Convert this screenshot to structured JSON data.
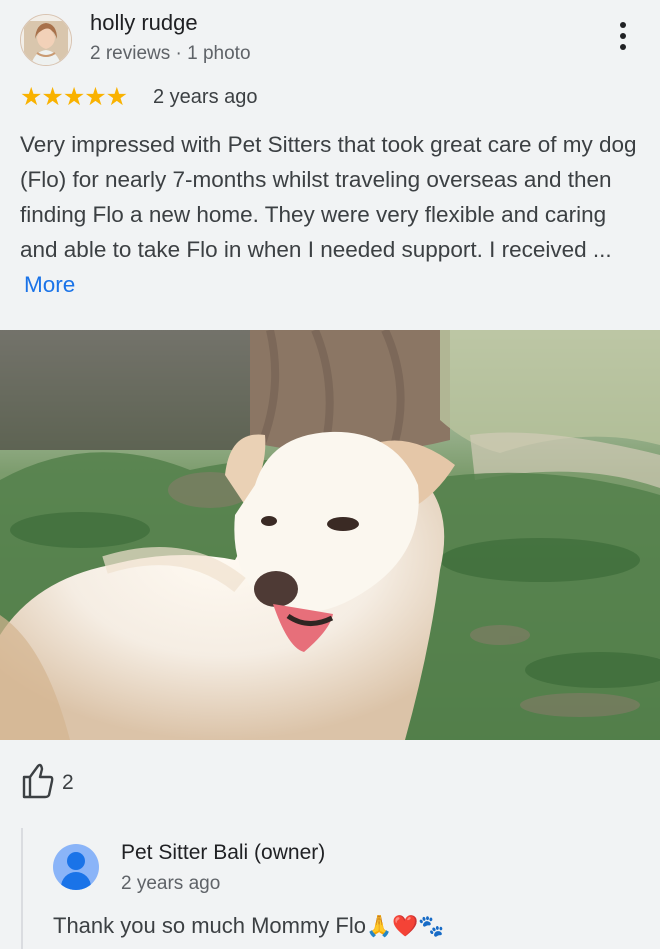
{
  "review": {
    "reviewer": {
      "name": "holly rudge",
      "meta": "2 reviews · 1 photo"
    },
    "rating": {
      "stars": 5,
      "star_symbol": "★★★★★",
      "age": "2 years ago"
    },
    "text": "Very impressed with Pet Sitters that took great care of my dog (Flo) for nearly 7-months whilst traveling overseas and then finding Flo a new home. They were very flexible and caring and able to take Flo in when I needed support. I received ...",
    "more_label": "More",
    "photo_icon": "review-photo-dog",
    "likes": "2"
  },
  "owner_response": {
    "name": "Pet Sitter Bali (owner)",
    "age": "2 years ago",
    "message": "Thank you so much Mommy Flo",
    "emoji": "🙏❤️🐾"
  },
  "colors": {
    "star": "#f9b200",
    "link": "#1a73e8",
    "owner_avatar": "#8ab4f8"
  }
}
